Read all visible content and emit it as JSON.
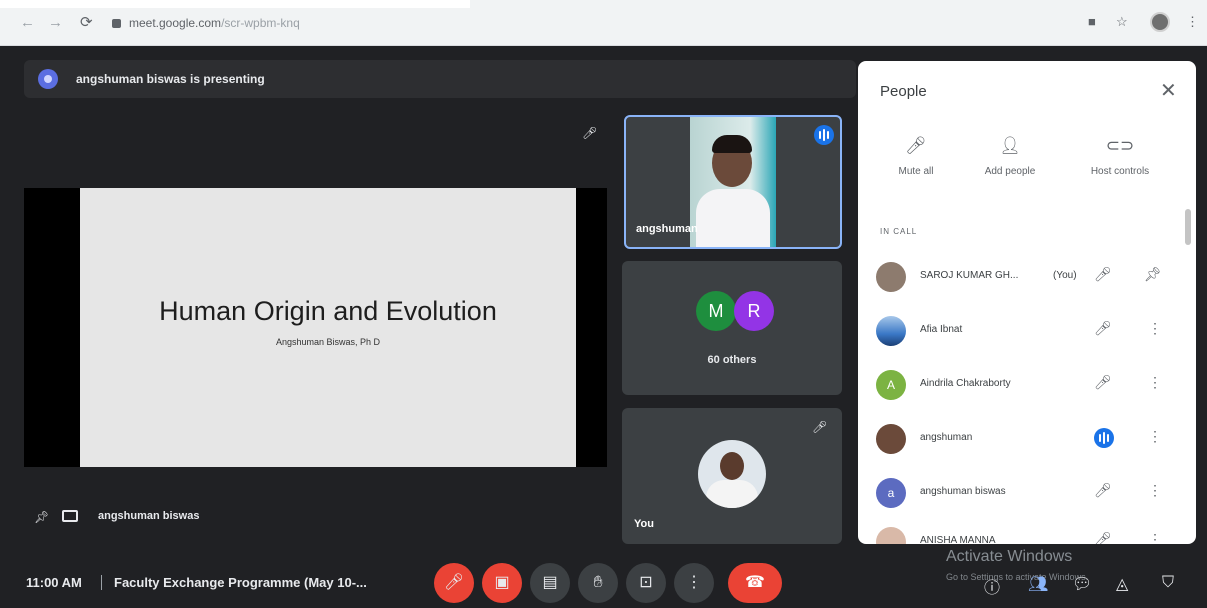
{
  "browser": {
    "back": "←",
    "forward": "→",
    "reload": "⟳",
    "url_host": "meet.google.com",
    "url_path": "/scr-wpbm-knq",
    "ext_icons": [
      "■",
      "☆",
      "⋮"
    ]
  },
  "presenting_bar": {
    "text": "angshuman biswas is presenting"
  },
  "slide": {
    "title": "Human Origin and Evolution",
    "subtitle": "Angshuman Biswas, Ph D"
  },
  "tiles": {
    "speaker_name": "angshuman",
    "others_avatars": [
      "M",
      "R"
    ],
    "others_label": "60 others",
    "self_label": "You"
  },
  "pinned_label": "angshuman biswas",
  "bottom_bar": {
    "time": "11:00 AM",
    "meeting_title": "Faculty Exchange Programme (May 10-...",
    "end_call_icon": "phone-hangup-icon"
  },
  "watermark": {
    "line1": "Activate Windows",
    "line2": "Go to Settings to activate Windows."
  },
  "people_panel": {
    "title": "People",
    "actions": [
      {
        "label": "Mute all",
        "icon": "mic-off-icon"
      },
      {
        "label": "Add people",
        "icon": "person-add-icon"
      },
      {
        "label": "Host controls",
        "icon": "toggle-icon"
      }
    ],
    "section_label": "IN CALL",
    "participants": [
      {
        "name": "SAROJ KUMAR GH...",
        "tag": "(You)",
        "avatar": "",
        "avatar_color": "#8d7b6e"
      },
      {
        "name": "Afia Ibnat",
        "tag": "",
        "avatar": "",
        "avatar_color": "#3a78c6"
      },
      {
        "name": "Aindrila Chakraborty",
        "tag": "",
        "avatar": "A",
        "avatar_color": "#7cb342"
      },
      {
        "name": "angshuman",
        "tag": "",
        "avatar": "",
        "avatar_color": "#6b4a3a"
      },
      {
        "name": "angshuman biswas",
        "tag": "",
        "avatar": "a",
        "avatar_color": "#5c6bc0"
      },
      {
        "name": "ANISHA MANNA",
        "tag": "",
        "avatar": "",
        "avatar_color": "#d9b9a8"
      }
    ]
  },
  "colors": {
    "accent": "#1a73e8",
    "danger": "#ea4335",
    "bg": "#202124",
    "tile": "#3c4043"
  }
}
